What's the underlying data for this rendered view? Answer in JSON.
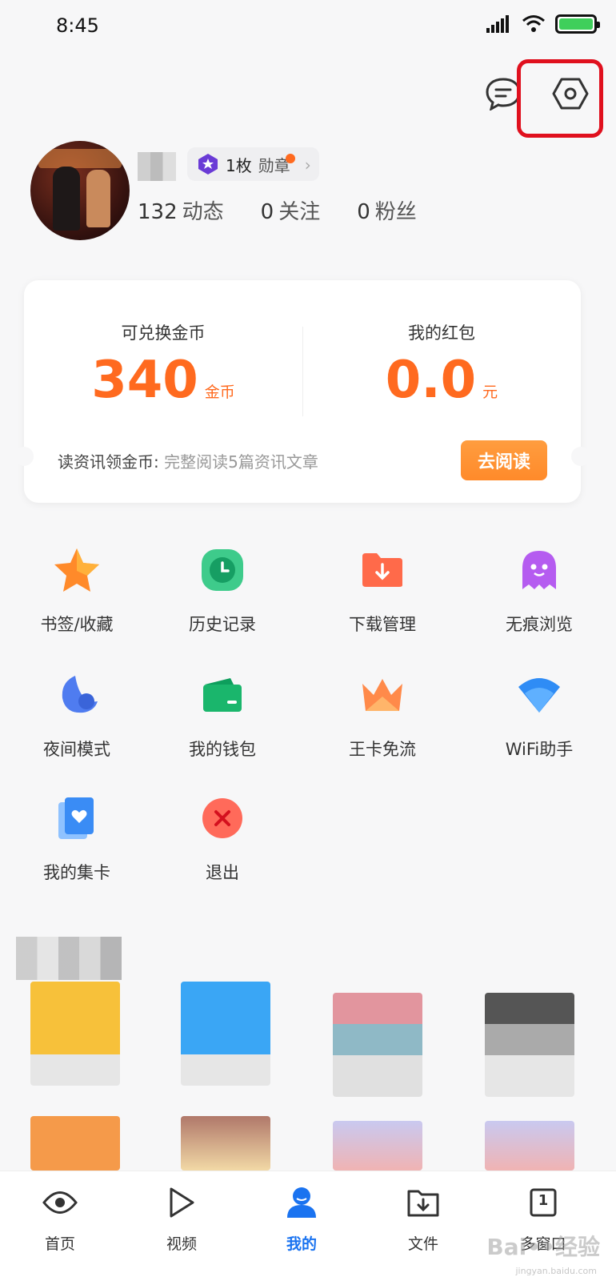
{
  "status_bar": {
    "time": "8:45"
  },
  "profile": {
    "medal_count": "1枚",
    "medal_label": "勋章",
    "stats": [
      {
        "num": "132",
        "label": "动态"
      },
      {
        "num": "0",
        "label": "关注"
      },
      {
        "num": "0",
        "label": "粉丝"
      }
    ]
  },
  "coin_card": {
    "coins_title": "可兑换金币",
    "coins_value": "340",
    "coins_unit": "金币",
    "redpack_title": "我的红包",
    "redpack_value": "0.0",
    "redpack_unit": "元",
    "read_prompt": "读资讯领金币:",
    "read_detail": "完整阅读5篇资讯文章",
    "read_button": "去阅读"
  },
  "grid": [
    {
      "label": "书签/收藏",
      "icon": "star-icon"
    },
    {
      "label": "历史记录",
      "icon": "clock-icon"
    },
    {
      "label": "下载管理",
      "icon": "download-folder-icon"
    },
    {
      "label": "无痕浏览",
      "icon": "ghost-icon"
    },
    {
      "label": "夜间模式",
      "icon": "moon-icon"
    },
    {
      "label": "我的钱包",
      "icon": "wallet-icon"
    },
    {
      "label": "王卡免流",
      "icon": "crown-icon"
    },
    {
      "label": "WiFi助手",
      "icon": "wifi-icon"
    },
    {
      "label": "我的集卡",
      "icon": "card-heart-icon"
    },
    {
      "label": "退出",
      "icon": "exit-icon"
    }
  ],
  "tabbar": [
    {
      "label": "首页",
      "icon": "eye-icon"
    },
    {
      "label": "视频",
      "icon": "play-icon"
    },
    {
      "label": "我的",
      "icon": "user-icon"
    },
    {
      "label": "文件",
      "icon": "file-download-icon"
    },
    {
      "label": "多窗口",
      "icon": "windows-icon",
      "badge": "1"
    }
  ],
  "colors": {
    "accent": "#ff6a1f",
    "active_tab": "#1a73f0",
    "highlight": "#e0101e"
  }
}
